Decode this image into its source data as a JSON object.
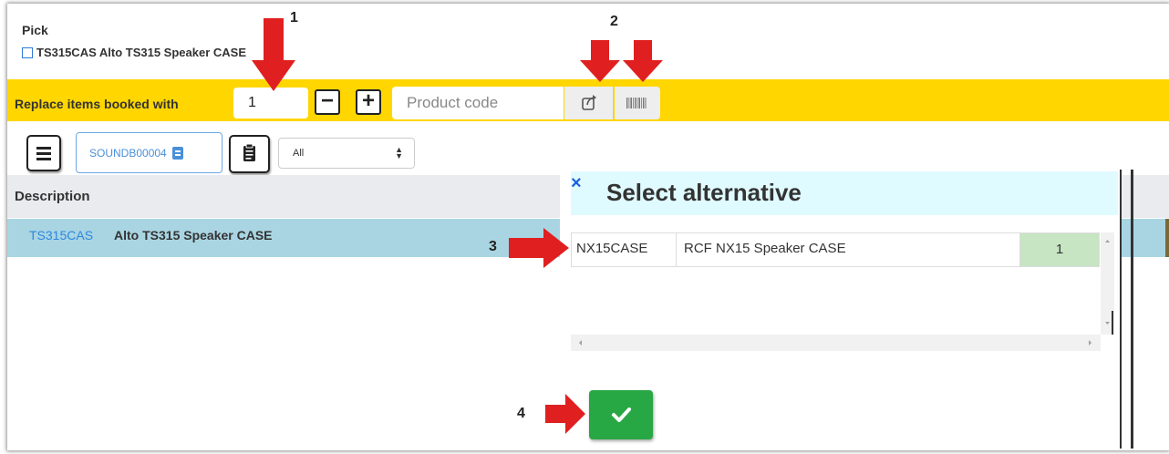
{
  "pick": {
    "title": "Pick",
    "item_text": "TS315CAS Alto TS315 Speaker CASE"
  },
  "toolbar": {
    "replace_label": "Replace items booked with",
    "quantity_value": "1",
    "minus_label": "−",
    "plus_label": "+",
    "product_code_placeholder": "Product code",
    "share_icon": "share-icon",
    "barcode_icon": "barcode-icon"
  },
  "filters": {
    "menu_icon": "hamburger-menu-icon",
    "booking_ref": "SOUNDB00004",
    "book_icon": "book-icon",
    "clipboard_icon": "clipboard-icon",
    "status_selected": "All"
  },
  "table": {
    "header": "Description",
    "rows": [
      {
        "code": "TS315CAS",
        "name": "Alto TS315 Speaker CASE"
      }
    ]
  },
  "modal": {
    "close_label": "×",
    "title": "Select alternative",
    "alternatives": [
      {
        "code": "NX15CASE",
        "name": "RCF NX15 Speaker CASE",
        "qty": "1"
      }
    ],
    "confirm_icon": "checkmark-icon"
  },
  "annotations": {
    "labels": [
      "1",
      "2",
      "3",
      "4"
    ],
    "arrow_color": "#e02020"
  },
  "colors": {
    "toolbar_bg": "#ffd600",
    "selected_row": "#a9d5e3",
    "qty_cell": "#c7e4c3",
    "confirm_button": "#28a745",
    "link_blue": "#2e86de"
  }
}
